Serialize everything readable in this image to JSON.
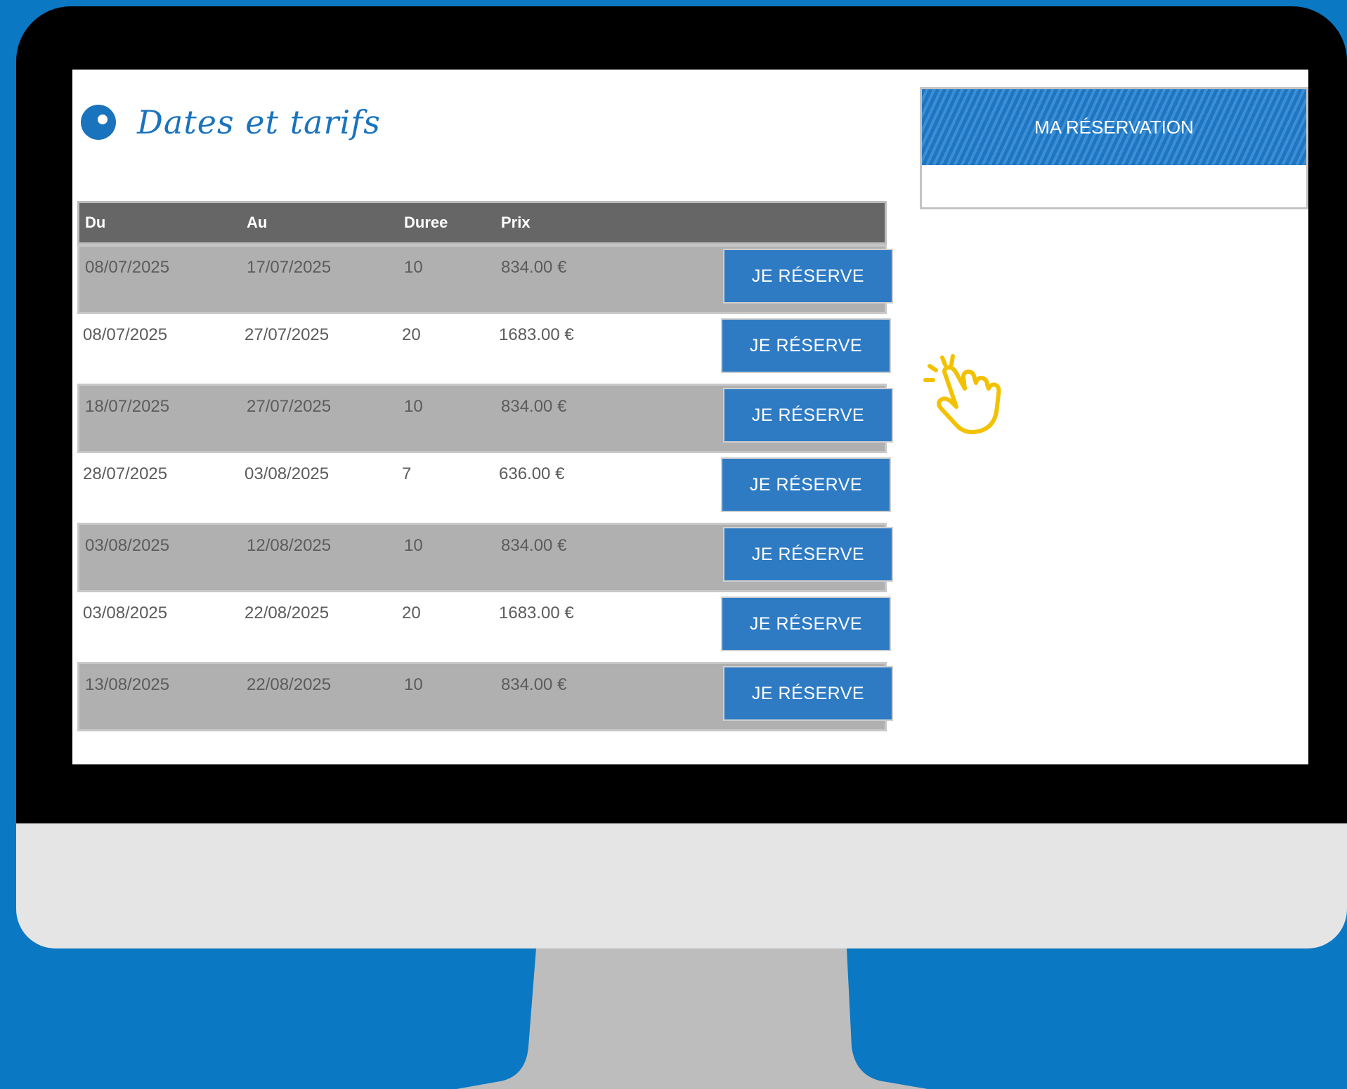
{
  "section": {
    "title": "Dates et tarifs"
  },
  "table": {
    "headers": {
      "du": "Du",
      "au": "Au",
      "duree": "Duree",
      "prix": "Prix"
    },
    "button_label": "JE RÉSERVE",
    "rows": [
      {
        "du": "08/07/2025",
        "au": "17/07/2025",
        "duree": "10",
        "prix": "834.00 €"
      },
      {
        "du": "08/07/2025",
        "au": "27/07/2025",
        "duree": "20",
        "prix": "1683.00 €"
      },
      {
        "du": "18/07/2025",
        "au": "27/07/2025",
        "duree": "10",
        "prix": "834.00 €"
      },
      {
        "du": "28/07/2025",
        "au": "03/08/2025",
        "duree": "7",
        "prix": "636.00 €"
      },
      {
        "du": "03/08/2025",
        "au": "12/08/2025",
        "duree": "10",
        "prix": "834.00 €"
      },
      {
        "du": "03/08/2025",
        "au": "22/08/2025",
        "duree": "20",
        "prix": "1683.00 €"
      },
      {
        "du": "13/08/2025",
        "au": "22/08/2025",
        "duree": "10",
        "prix": "834.00 €"
      }
    ]
  },
  "reservation": {
    "title": "MA RÉSERVATION"
  },
  "colors": {
    "background": "#0a78c2",
    "accent": "#2e7bc4",
    "cursor": "#f2c200"
  }
}
